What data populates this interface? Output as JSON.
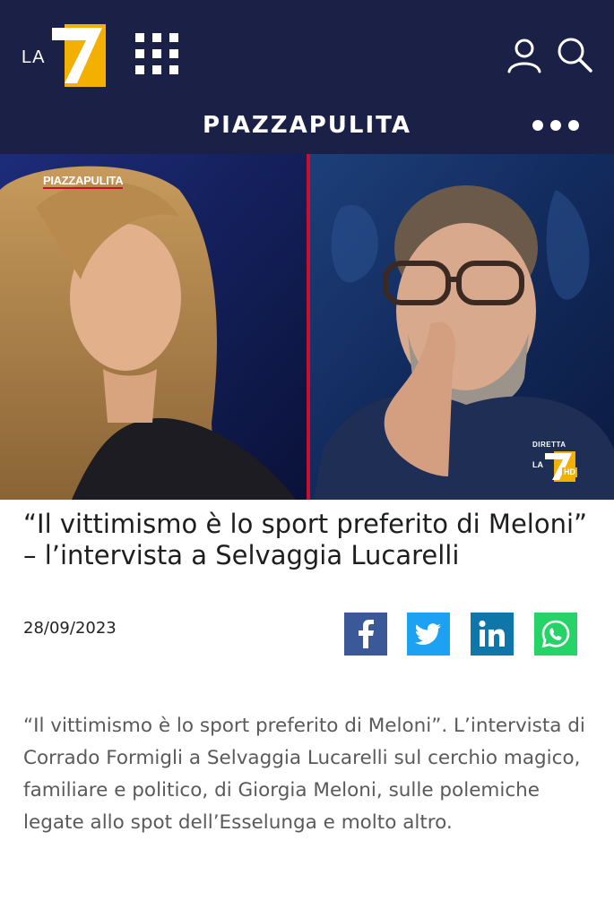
{
  "header": {
    "logo_text": "LA",
    "show_title": "PIAZZAPULITA",
    "icons": [
      "grid-menu-icon",
      "user-icon",
      "search-icon",
      "more-options-icon"
    ],
    "colors": {
      "background": "#1b2146",
      "logo_accent": "#f3b000"
    }
  },
  "video": {
    "watermark_left": "PIAZZAPULITA",
    "watermark_right_top": "DIRETTA",
    "watermark_right_logo": "LA",
    "watermark_right_hd": "HD",
    "divider_color": "#c8102e"
  },
  "article": {
    "title": "“Il vittimismo è lo sport preferito di Meloni” – l’intervista a Selvaggia Lucarelli",
    "date": "28/09/2023",
    "description": "“Il vittimismo è lo sport preferito di Meloni”. L’intervista di Corrado Formigli a Selvaggia Lucarelli sul cerchio magico, familiare e politico, di Giorgia Meloni, sulle polemiche legate allo spot dell’Esselunga e molto altro."
  },
  "share": {
    "buttons": [
      {
        "name": "facebook",
        "icon": "facebook-icon",
        "color": "#3b5998"
      },
      {
        "name": "twitter",
        "icon": "twitter-icon",
        "color": "#1da1f2"
      },
      {
        "name": "linkedin",
        "icon": "linkedin-icon",
        "color": "#0e76a8"
      },
      {
        "name": "whatsapp",
        "icon": "whatsapp-icon",
        "color": "#25d366"
      }
    ]
  }
}
